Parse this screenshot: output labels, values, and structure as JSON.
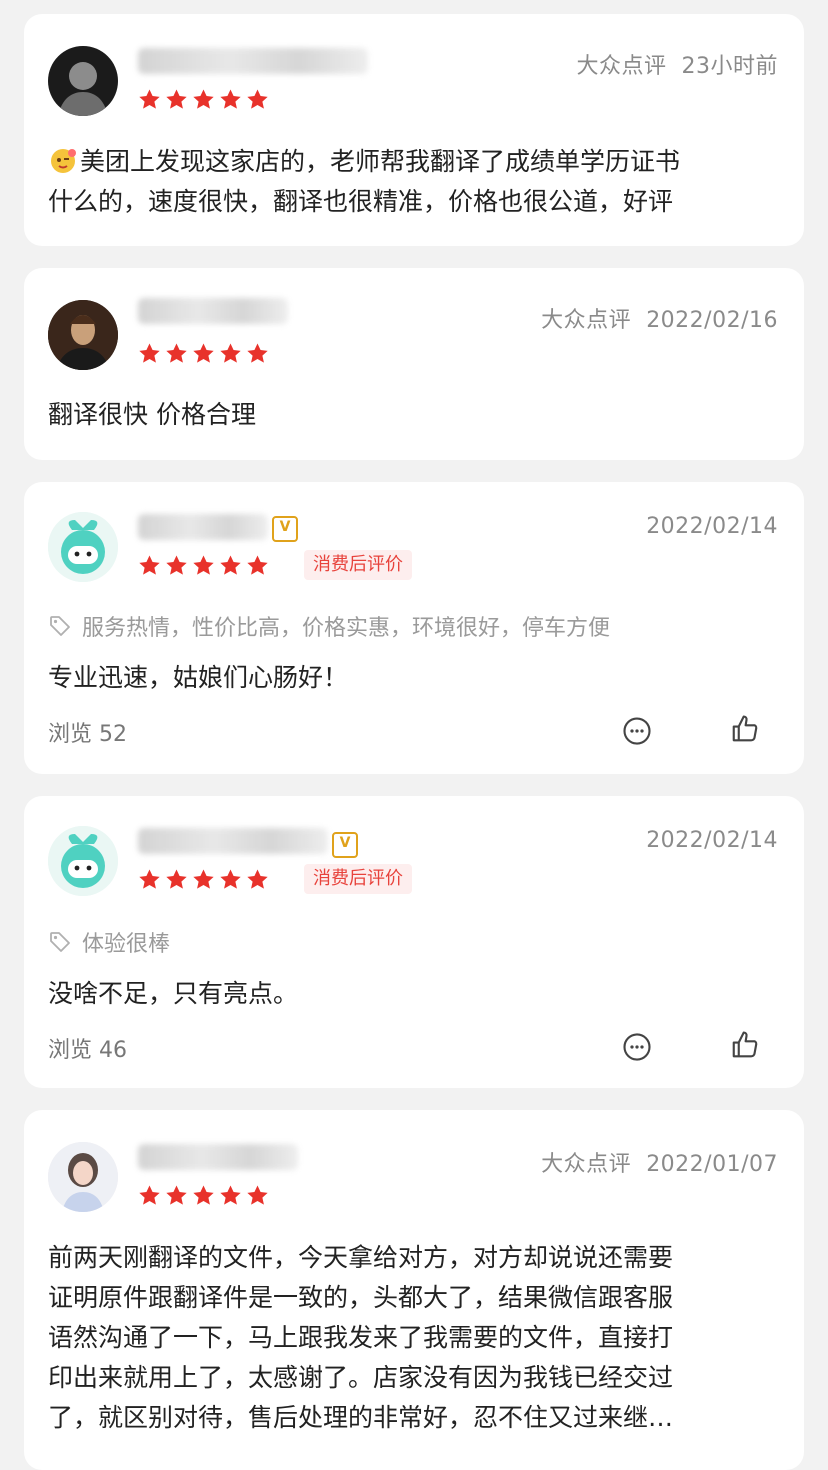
{
  "reviews": [
    {
      "source": "大众点评",
      "time": "23小时前",
      "text_lines": [
        "美团上发现这家店的，老师帮我翻译了成绩单学历证书",
        "什么的，速度很快，翻译也很精准，价格也很公道，好评"
      ],
      "has_emoji": true
    },
    {
      "source": "大众点评",
      "time": "2022/02/16",
      "text_lines": [
        "翻译很快 价格合理"
      ]
    },
    {
      "time": "2022/02/14",
      "badge": "消费后评价",
      "tags": "服务热情，性价比高，价格实惠，环境很好，停车方便",
      "text_lines": [
        "专业迅速，姑娘们心肠好！"
      ],
      "views": "浏览 52"
    },
    {
      "time": "2022/02/14",
      "badge": "消费后评价",
      "tags": "体验很棒",
      "text_lines": [
        "没啥不足，只有亮点。"
      ],
      "views": "浏览 46"
    },
    {
      "source": "大众点评",
      "time": "2022/01/07",
      "text_lines": [
        "前两天刚翻译的文件，今天拿给对方，对方却说说还需要",
        "证明原件跟翻译件是一致的，头都大了，结果微信跟客服",
        "语然沟通了一下，马上跟我发来了我需要的文件，直接打",
        "印出来就用上了，太感谢了。店家没有因为我钱已经交过",
        "了，就区别对待，售后处理的非常好，忍不住又过来继…"
      ]
    }
  ],
  "colors": {
    "star": "#e8322b",
    "badge_bg": "#fdeeee",
    "badge_text": "#e8433c",
    "vip": "#e0a21b"
  },
  "rating": 5,
  "icons": [
    "star-icon",
    "tag-icon",
    "comment-icon",
    "thumbs-up-icon",
    "verified-badge-icon"
  ]
}
